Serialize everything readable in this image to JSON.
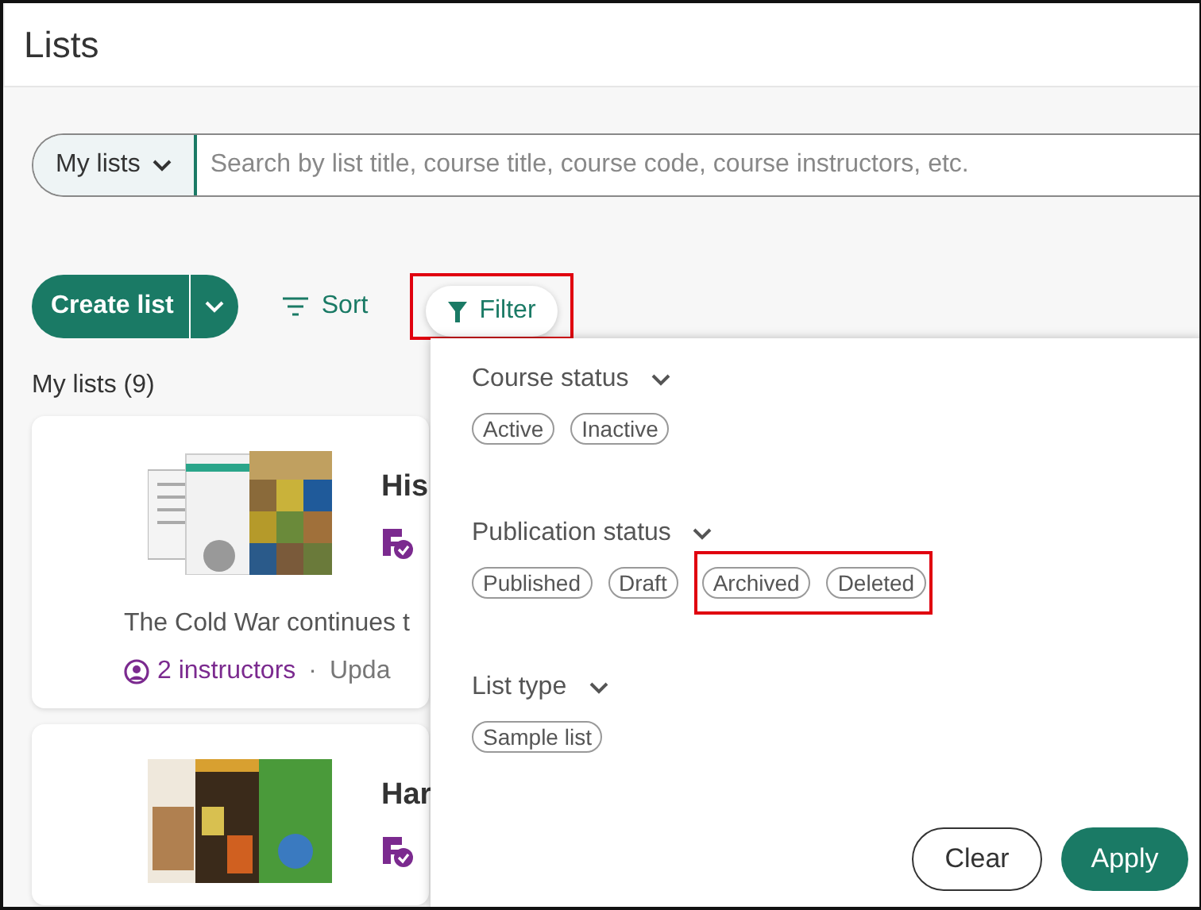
{
  "page": {
    "title": "Lists"
  },
  "search": {
    "scope": "My lists",
    "placeholder": "Search by list title, course title, course code, course instructors, etc."
  },
  "toolbar": {
    "create_button": "Create list",
    "sort_button": "Sort",
    "filter_button": {
      "label": "Filter",
      "highlighted": true
    }
  },
  "list_heading": "My lists (9)",
  "cards": [
    {
      "title": "His",
      "description": "The Cold War continues t",
      "instructors": "2 instructors",
      "separator": "·",
      "updated": "Upda",
      "kind": "history"
    },
    {
      "title": "Har",
      "kind": "biology"
    }
  ],
  "filter_panel": {
    "sections": [
      {
        "heading": "Course status",
        "chip_groups": [
          {
            "highlighted": false,
            "chips": [
              "Active",
              "Inactive"
            ]
          }
        ]
      },
      {
        "heading": "Publication status",
        "chip_groups": [
          {
            "highlighted": false,
            "chips": [
              "Published",
              "Draft"
            ]
          },
          {
            "highlighted": true,
            "chips": [
              "Archived",
              "Deleted"
            ]
          }
        ]
      },
      {
        "heading": "List type",
        "chip_groups": [
          {
            "highlighted": false,
            "chips": [
              "Sample list"
            ]
          }
        ]
      }
    ],
    "clear_button": "Clear",
    "apply_button": "Apply"
  }
}
